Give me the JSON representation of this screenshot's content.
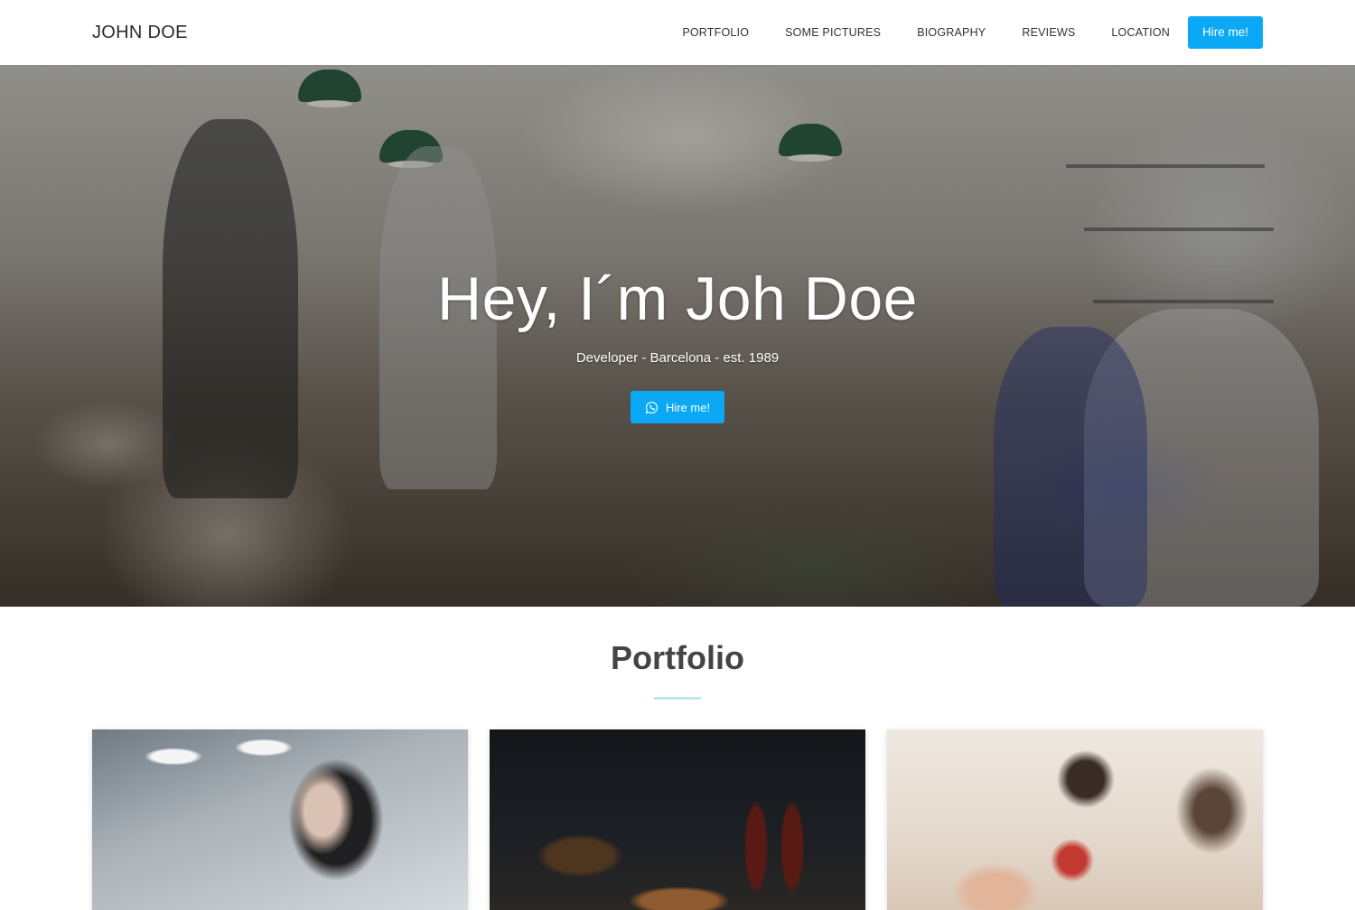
{
  "navbar": {
    "brand": "JOHN DOE",
    "links": [
      "PORTFOLIO",
      "SOME PICTURES",
      "BIOGRAPHY",
      "REVIEWS",
      "LOCATION"
    ],
    "cta_label": "Hire me!"
  },
  "hero": {
    "title": "Hey, I´m Joh Doe",
    "subtitle": "Developer - Barcelona - est. 1989",
    "button_label": "Hire me!",
    "button_icon": "whatsapp-icon"
  },
  "portfolio": {
    "title": "Portfolio",
    "cards": [
      {
        "image": "woman-portrait-image"
      },
      {
        "image": "coca-cola-bottles-image"
      },
      {
        "image": "tattoo-hand-image"
      }
    ]
  },
  "colors": {
    "accent": "#0aa8f5",
    "divider": "#bfe5f0",
    "heading": "#444444"
  }
}
